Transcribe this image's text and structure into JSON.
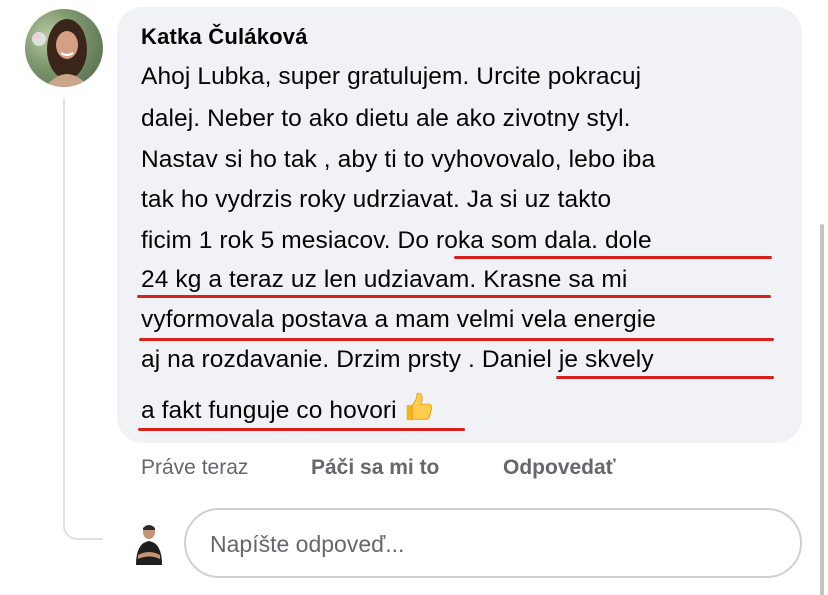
{
  "comment": {
    "author": "Katka Čuláková",
    "lines": [
      "Ahoj Lubka, super gratulujem. Urcite pokracuj",
      "dalej. Neber to ako dietu ale ako zivotny styl.",
      "Nastav si ho tak , aby ti to vyhovovalo, lebo iba",
      "tak ho vydrzis roky udrziavat. Ja si uz takto",
      "ficim 1 rok 5 mesiacov. Do roka som dala. dole",
      "24 kg a teraz uz len udziavam. Krasne sa mi",
      "vyformovala postava a mam velmi vela energie",
      "aj na rozdavanie. Drzim prsty . Daniel je skvely",
      "a fakt funguje co hovori"
    ],
    "emoji": "thumbs-up-icon"
  },
  "actions": {
    "time": "Práve teraz",
    "like": "Páči sa mi to",
    "reply": "Odpovedať"
  },
  "reply_box": {
    "placeholder": "Napíšte odpoveď..."
  },
  "colors": {
    "bubble": "#f0f2f5",
    "underline": "#d9211c",
    "muted_text": "#65676b"
  }
}
